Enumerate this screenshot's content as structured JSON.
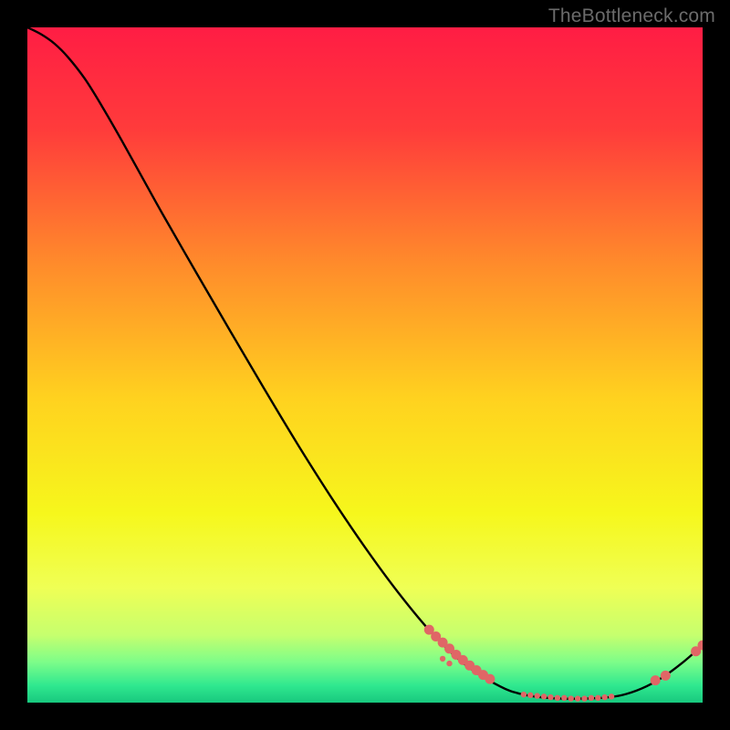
{
  "watermark": "TheBottleneck.com",
  "chart_data": {
    "type": "line",
    "title": "",
    "xlabel": "",
    "ylabel": "",
    "xlim": [
      0,
      100
    ],
    "ylim": [
      0,
      100
    ],
    "grid": false,
    "legend": false,
    "gradient_stops": [
      {
        "offset": 0.0,
        "color": "#ff1d44"
      },
      {
        "offset": 0.15,
        "color": "#ff3b3b"
      },
      {
        "offset": 0.35,
        "color": "#ff8b2b"
      },
      {
        "offset": 0.55,
        "color": "#ffd21f"
      },
      {
        "offset": 0.72,
        "color": "#f6f71c"
      },
      {
        "offset": 0.83,
        "color": "#efff55"
      },
      {
        "offset": 0.9,
        "color": "#c6ff6e"
      },
      {
        "offset": 0.94,
        "color": "#7dfd89"
      },
      {
        "offset": 0.975,
        "color": "#2fe88f"
      },
      {
        "offset": 1.0,
        "color": "#18c87e"
      }
    ],
    "series": [
      {
        "name": "bottleneck-curve",
        "color": "#000000",
        "x": [
          0.0,
          2.0,
          4.0,
          6.0,
          8.5,
          11.0,
          14.0,
          17.0,
          20.0,
          25.0,
          30.0,
          35.0,
          40.0,
          45.0,
          50.0,
          55.0,
          60.0,
          65.0,
          70.0,
          73.0,
          76.0,
          79.0,
          82.0,
          85.0,
          88.0,
          91.0,
          94.0,
          97.0,
          100.0
        ],
        "y": [
          100.0,
          99.0,
          97.6,
          95.6,
          92.4,
          88.4,
          83.2,
          77.8,
          72.4,
          63.7,
          55.1,
          46.6,
          38.3,
          30.4,
          23.0,
          16.2,
          10.2,
          5.5,
          2.4,
          1.3,
          0.8,
          0.6,
          0.6,
          0.7,
          1.1,
          2.1,
          3.7,
          5.9,
          8.5
        ]
      }
    ],
    "marker_clusters": [
      {
        "name": "left-cluster",
        "color": "#e06666",
        "radius_main": 5.5,
        "radius_minor": 3.2,
        "points": [
          {
            "x": 59.5,
            "y": 10.8
          },
          {
            "x": 60.5,
            "y": 9.8
          },
          {
            "x": 61.5,
            "y": 8.9
          },
          {
            "x": 62.5,
            "y": 8.0
          },
          {
            "x": 63.5,
            "y": 7.1
          },
          {
            "x": 64.5,
            "y": 6.3
          },
          {
            "x": 65.5,
            "y": 5.5
          },
          {
            "x": 66.5,
            "y": 4.8
          },
          {
            "x": 67.5,
            "y": 4.1
          },
          {
            "x": 68.5,
            "y": 3.5
          },
          {
            "x": 61.5,
            "y": 6.5,
            "minor": true
          },
          {
            "x": 62.5,
            "y": 5.8,
            "minor": true
          }
        ]
      },
      {
        "name": "bottom-cluster",
        "color": "#e06666",
        "radius_main": 3.2,
        "radius_minor": 3.2,
        "points": [
          {
            "x": 73.5,
            "y": 1.2
          },
          {
            "x": 74.5,
            "y": 1.1
          },
          {
            "x": 75.5,
            "y": 1.0
          },
          {
            "x": 76.5,
            "y": 0.9
          },
          {
            "x": 77.5,
            "y": 0.8
          },
          {
            "x": 78.5,
            "y": 0.7
          },
          {
            "x": 79.5,
            "y": 0.7
          },
          {
            "x": 80.5,
            "y": 0.6
          },
          {
            "x": 81.5,
            "y": 0.6
          },
          {
            "x": 82.5,
            "y": 0.6
          },
          {
            "x": 83.5,
            "y": 0.7
          },
          {
            "x": 84.5,
            "y": 0.7
          },
          {
            "x": 85.5,
            "y": 0.8
          },
          {
            "x": 86.5,
            "y": 0.9
          }
        ]
      },
      {
        "name": "right-cluster",
        "color": "#e06666",
        "radius_main": 5.5,
        "radius_minor": 3.2,
        "points": [
          {
            "x": 93.0,
            "y": 3.3
          },
          {
            "x": 94.5,
            "y": 4.0
          },
          {
            "x": 99.0,
            "y": 7.6
          },
          {
            "x": 100.0,
            "y": 8.5
          }
        ]
      }
    ]
  }
}
